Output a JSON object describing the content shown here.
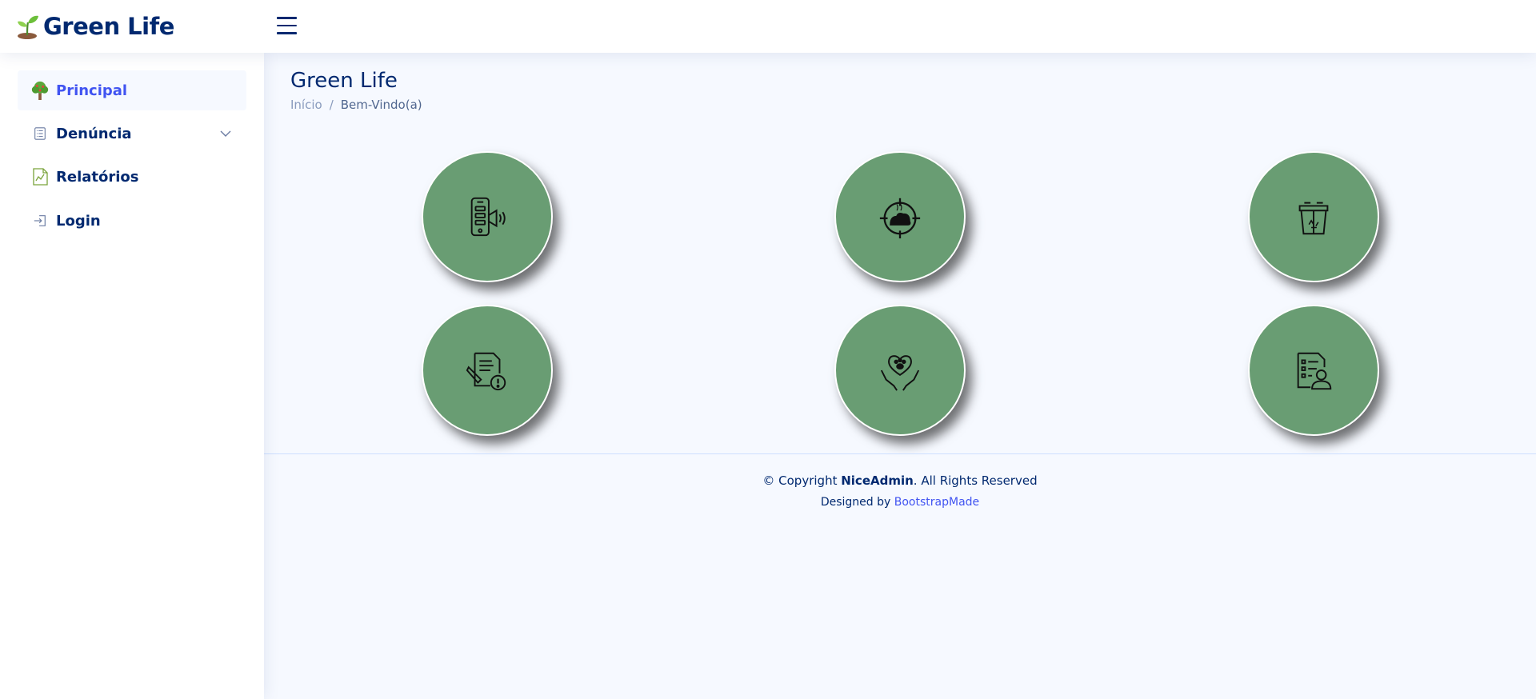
{
  "header": {
    "brand": "Green Life",
    "logo_icon": "sprout-icon",
    "menu_icon": "hamburger-icon"
  },
  "sidebar": {
    "items": [
      {
        "label": "Principal",
        "icon": "tree-icon",
        "active": true
      },
      {
        "label": "Denúncia",
        "icon": "list-document-icon",
        "has_dropdown": true
      },
      {
        "label": "Relatórios",
        "icon": "chart-document-icon"
      },
      {
        "label": "Login",
        "icon": "login-icon"
      }
    ]
  },
  "page": {
    "title": "Green Life",
    "breadcrumb": {
      "home": "Início",
      "separator": "/",
      "current": "Bem-Vindo(a)"
    }
  },
  "tiles": [
    {
      "icon": "phone-megaphone-icon"
    },
    {
      "icon": "target-pollution-icon"
    },
    {
      "icon": "recycle-bin-icon"
    },
    {
      "icon": "report-warning-icon"
    },
    {
      "icon": "animal-care-icon"
    },
    {
      "icon": "user-report-icon"
    }
  ],
  "footer": {
    "copyright_prefix": "© Copyright",
    "copyright_brand": "NiceAdmin",
    "copyright_suffix": ". All Rights Reserved",
    "designed_by": "Designed by",
    "designer": "BootstrapMade"
  },
  "colors": {
    "primary": "#012970",
    "accent": "#4154f1",
    "tile_green": "#699d73",
    "background": "#f6f9ff"
  }
}
